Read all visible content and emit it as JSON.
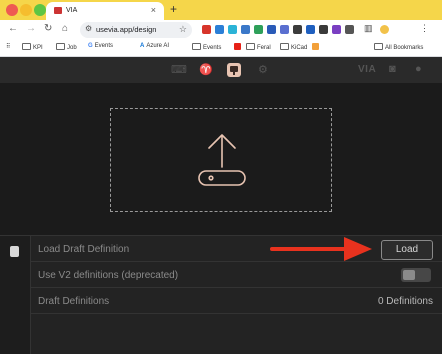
{
  "browser": {
    "tab": {
      "title": "VIA",
      "close": "×"
    },
    "new_tab": "+",
    "url": "usevia.app/design",
    "bookmarks": {
      "kpi": "KPI",
      "job": "Job",
      "events": "Events",
      "azure": "Azure AI",
      "events2": "Events",
      "feral": "Feral",
      "kicad": "KiCad",
      "all": "All Bookmarks"
    }
  },
  "app": {
    "brand": "VIA"
  },
  "settings": {
    "rows": [
      {
        "label": "Load Draft Definition",
        "button": "Load"
      },
      {
        "label": "Use V2 definitions (deprecated)",
        "toggle_on": false
      },
      {
        "label": "Draft Definitions",
        "value": "0 Definitions"
      }
    ]
  },
  "colors": {
    "accent": "#e8c4b2",
    "arrow": "#e8321e",
    "browser_frame": "#f5d64a"
  }
}
